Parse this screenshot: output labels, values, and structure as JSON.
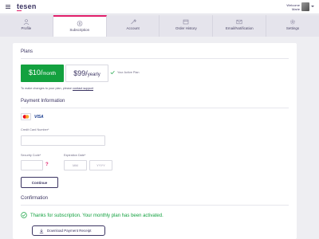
{
  "header": {
    "logo": "tesen",
    "welcome_line": "Welcome",
    "user_name": "Marie"
  },
  "tabs": [
    {
      "label": "Profile",
      "icon": "user-icon"
    },
    {
      "label": "Subscription",
      "icon": "dollar-icon"
    },
    {
      "label": "Account",
      "icon": "wrench-icon"
    },
    {
      "label": "Order History",
      "icon": "order-icon"
    },
    {
      "label": "Email/Notification",
      "icon": "mail-icon"
    },
    {
      "label": "Settings",
      "icon": "gear-icon"
    }
  ],
  "active_tab": "Subscription",
  "plans": {
    "title": "Plans",
    "monthly_price": "$10/",
    "monthly_unit": "month",
    "yearly_price": "$99/",
    "yearly_unit": "yearly",
    "active_label": "Your Active Plan",
    "note": "To make changes to your plan, please",
    "note_link": "contact support"
  },
  "payment": {
    "title": "Payment Information",
    "card_brand": "VISA",
    "card_number_label": "Credit Card Number*",
    "security_label": "Security Code*",
    "expiry_label": "Expiration Date*",
    "month_placeholder": "MM",
    "year_placeholder": "YYYY",
    "help_mark": "?",
    "continue_label": "Continue"
  },
  "confirmation": {
    "title": "Confirmation",
    "message": "Thanks for subscription. Your monthly plan has been activated.",
    "download_label": "Download Payment Receipt"
  },
  "colors": {
    "accent": "#e01e6a",
    "success": "#13a13f",
    "primary_text": "#3b3462",
    "background": "#eeeef2"
  }
}
